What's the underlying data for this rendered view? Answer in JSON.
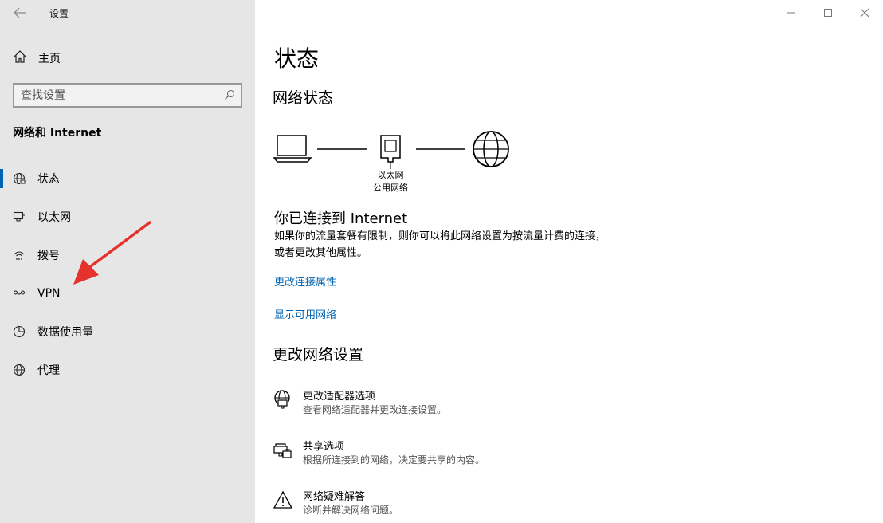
{
  "window": {
    "title": "设置",
    "back_icon": "back-arrow-icon",
    "controls": {
      "minimize": "—",
      "maximize": "☐",
      "close": "✕"
    }
  },
  "sidebar": {
    "home_label": "主页",
    "search_placeholder": "查找设置",
    "section_title": "网络和 Internet",
    "items": [
      {
        "label": "状态",
        "icon": "globe-status-icon",
        "active": true
      },
      {
        "label": "以太网",
        "icon": "ethernet-icon",
        "active": false
      },
      {
        "label": "拨号",
        "icon": "dialup-icon",
        "active": false
      },
      {
        "label": "VPN",
        "icon": "vpn-icon",
        "active": false
      },
      {
        "label": "数据使用量",
        "icon": "data-usage-icon",
        "active": false
      },
      {
        "label": "代理",
        "icon": "globe-icon",
        "active": false
      }
    ]
  },
  "main": {
    "title": "状态",
    "network_status_heading": "网络状态",
    "diagram": {
      "adapter_label": "以太网",
      "network_type": "公用网络"
    },
    "connected_title": "你已连接到 Internet",
    "connected_desc": "如果你的流量套餐有限制，则你可以将此网络设置为按流量计费的连接，或者更改其他属性。",
    "links": {
      "change_props": "更改连接属性",
      "show_networks": "显示可用网络"
    },
    "change_settings_heading": "更改网络设置",
    "options": [
      {
        "title": "更改适配器选项",
        "desc": "查看网络适配器并更改连接设置。",
        "icon": "adapter-icon"
      },
      {
        "title": "共享选项",
        "desc": "根据所连接到的网络，决定要共享的内容。",
        "icon": "sharing-icon"
      },
      {
        "title": "网络疑难解答",
        "desc": "诊断并解决网络问题。",
        "icon": "warning-icon"
      }
    ]
  },
  "colors": {
    "accent": "#0063b1",
    "sidebar_bg": "#e6e6e6",
    "annotation_arrow": "#e5322d"
  }
}
